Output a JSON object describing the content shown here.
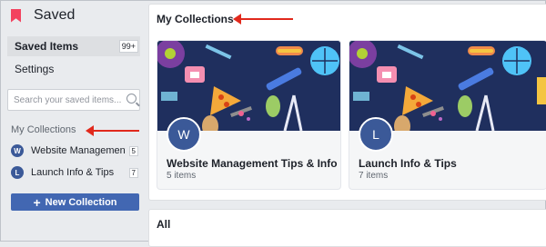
{
  "sidebar": {
    "title": "Saved",
    "nav": [
      {
        "label": "Saved Items",
        "badge": "99+"
      },
      {
        "label": "Settings"
      }
    ],
    "search": {
      "placeholder": "Search your saved items..."
    },
    "collections_heading": "My Collections",
    "collections": [
      {
        "initial": "W",
        "name": "Website Management Tips & Info",
        "count": "5"
      },
      {
        "initial": "L",
        "name": "Launch Info & Tips",
        "count": "7"
      }
    ],
    "new_collection_label": "New Collection"
  },
  "main": {
    "title": "My Collections",
    "cards": [
      {
        "initial": "W",
        "name": "Website Management Tips & Info",
        "count": "5 items"
      },
      {
        "initial": "L",
        "name": "Launch Info & Tips",
        "count": "7 items"
      }
    ],
    "all_title": "All"
  },
  "colors": {
    "accent_blue": "#4267b2",
    "avatar_blue": "#3b5998",
    "annotation_red": "#e1291c",
    "bookmark_pink": "#f3425f"
  },
  "icons": [
    "bookmark-icon",
    "search-icon",
    "plus-icon",
    "annotation-arrow"
  ]
}
